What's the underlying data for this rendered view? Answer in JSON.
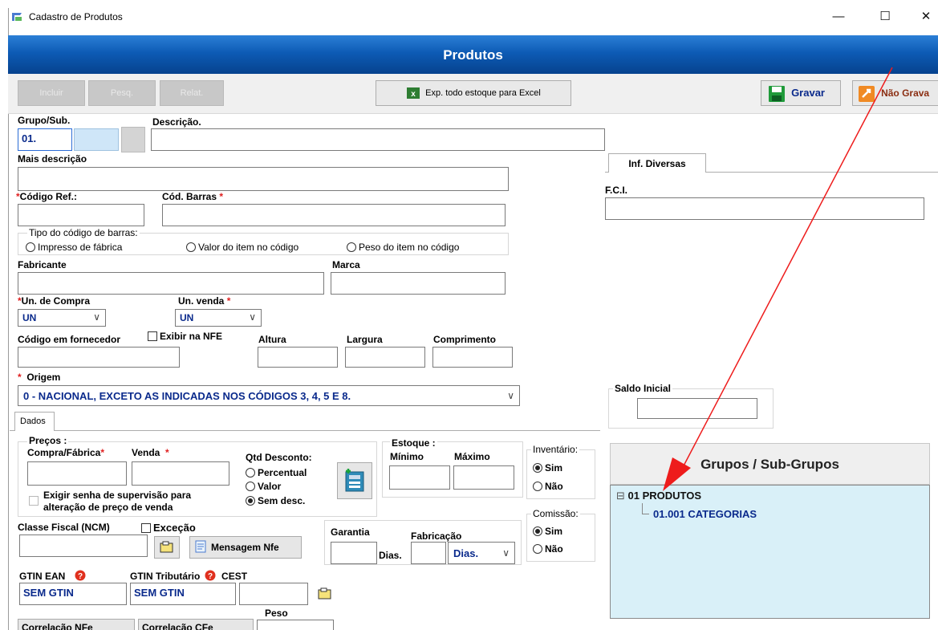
{
  "window": {
    "title": "Cadastro de Produtos",
    "minimize": "—",
    "maximize": "☐",
    "close": "✕"
  },
  "banner": {
    "title": "Produtos"
  },
  "toolbar": {
    "incluir": "Incluir",
    "pesq": "Pesq.",
    "relat": "Relat.",
    "export": "Exp. todo estoque para Excel",
    "gravar": "Gravar",
    "nao_gravar": "Não Grava"
  },
  "form": {
    "grupo_sub_label": "Grupo/Sub.",
    "grupo_value": "01.",
    "descricao_label": "Descrição.",
    "mais_descricao_label": "Mais descrição",
    "codigo_ref_label": "Código Ref.:",
    "cod_barras_label": "Cód. Barras",
    "required_mark": "*",
    "tipo_codigo_label": "Tipo do código de barras:",
    "tipo_options": [
      "Impresso de fábrica",
      "Valor do item no código",
      "Peso do item no código"
    ],
    "fabricante_label": "Fabricante",
    "marca_label": "Marca",
    "un_compra_label": "Un. de Compra",
    "un_compra_value": "UN",
    "un_venda_label": "Un. venda",
    "un_venda_value": "UN",
    "codigo_fornecedor_label": "Código em fornecedor",
    "exibir_nfe_label": "Exibir na NFE",
    "altura_label": "Altura",
    "largura_label": "Largura",
    "comprimento_label": "Comprimento",
    "origem_label": "Origem",
    "origem_value": "0 - NACIONAL, EXCETO AS INDICADAS NOS CÓDIGOS 3, 4, 5 E 8."
  },
  "dados": {
    "tab_label": "Dados",
    "precos_label": "Preços :",
    "compra_fabrica_label": "Compra/Fábrica",
    "venda_label": "Venda",
    "exigir_senha_line1": "Exigir senha de supervisão para",
    "exigir_senha_line2": "alteração de preço de venda",
    "qtd_desconto_label": "Qtd Desconto:",
    "desconto_options": [
      "Percentual",
      "Valor",
      "Sem desc."
    ],
    "estoque_label": "Estoque :",
    "minimo_label": "Mínimo",
    "maximo_label": "Máximo",
    "inventario_label": "Inventário:",
    "sim": "Sim",
    "nao": "Não",
    "comissao_label": "Comissão:",
    "classe_fiscal_label": "Classe Fiscal (NCM)",
    "excecao_label": "Exceção",
    "mensagem_nfe": "Mensagem Nfe",
    "garantia_label": "Garantia",
    "fabricacao_label": "Fabricação",
    "dias_label": "Dias.",
    "dias_select_value": "Dias.",
    "gtin_ean_label": "GTIN EAN",
    "gtin_trib_label": "GTIN Tributário",
    "cest_label": "CEST",
    "gtin_ean_value": "SEM GTIN",
    "gtin_trib_value": "SEM GTIN",
    "peso_label": "Peso",
    "correlacao_nfe": "Correlação NFe",
    "correlacao_cfe": "Correlação CFe"
  },
  "right": {
    "tab_inf_diversas": "Inf. Diversas",
    "fci_label": "F.C.I.",
    "saldo_inicial_label": "Saldo Inicial",
    "grupos_title": "Grupos / Sub-Grupos",
    "tree": [
      {
        "label": "01 PRODUTOS",
        "toggle": "⊟"
      },
      {
        "label": "01.001 CATEGORIAS"
      }
    ]
  },
  "colors": {
    "banner_blue": "#0d5bb5",
    "field_text_blue": "#0a2a8c",
    "required_red": "#e02020",
    "tree_bg": "#d9f0f8",
    "annotation_arrow": "#ee1c1c"
  }
}
